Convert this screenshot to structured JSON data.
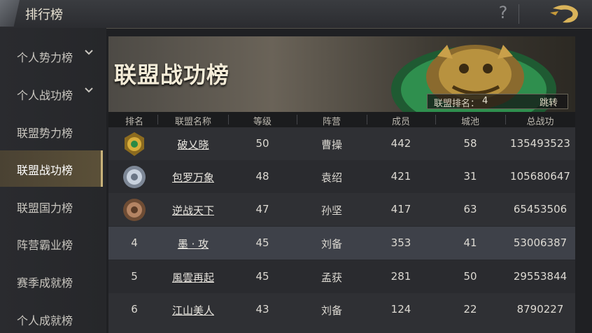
{
  "header": {
    "title": "排行榜",
    "help_glyph": "?"
  },
  "sidebar": {
    "items": [
      {
        "label": "个人势力榜",
        "has_chevron": true
      },
      {
        "label": "个人战功榜",
        "has_chevron": true
      },
      {
        "label": "联盟势力榜",
        "has_chevron": false
      },
      {
        "label": "联盟战功榜",
        "has_chevron": false,
        "active": true
      },
      {
        "label": "联盟国力榜",
        "has_chevron": false
      },
      {
        "label": "阵营霸业榜",
        "has_chevron": false
      },
      {
        "label": "赛季成就榜",
        "has_chevron": false
      },
      {
        "label": "个人成就榜",
        "has_chevron": false
      }
    ]
  },
  "banner": {
    "title": "联盟战功榜",
    "rank_label": "联盟排名：",
    "rank_value": "4",
    "jump_label": "跳转"
  },
  "table": {
    "headers": [
      "排名",
      "联盟名称",
      "等级",
      "阵营",
      "成员",
      "城池",
      "总战功"
    ],
    "rows": [
      {
        "rank": "",
        "medal": "gold-medal-icon",
        "name": "破乂晓",
        "level": "50",
        "camp": "曹操",
        "members": "442",
        "cities": "58",
        "merit": "135493523"
      },
      {
        "rank": "",
        "medal": "silver-medal-icon",
        "name": "包罗万象",
        "level": "48",
        "camp": "袁绍",
        "members": "421",
        "cities": "31",
        "merit": "105680647"
      },
      {
        "rank": "",
        "medal": "bronze-medal-icon",
        "name": "逆战天下",
        "level": "47",
        "camp": "孙坚",
        "members": "417",
        "cities": "63",
        "merit": "65453506"
      },
      {
        "rank": "4",
        "name": "墨 · 攻",
        "level": "45",
        "camp": "刘备",
        "members": "353",
        "cities": "41",
        "merit": "53006387"
      },
      {
        "rank": "5",
        "name": "風雲再起",
        "level": "45",
        "camp": "孟获",
        "members": "281",
        "cities": "50",
        "merit": "29553844"
      },
      {
        "rank": "6",
        "name": "江山美人",
        "level": "43",
        "camp": "刘备",
        "members": "124",
        "cities": "22",
        "merit": "8790227"
      }
    ]
  },
  "colors": {
    "accent": "#c8b27a",
    "highlight_row": "#3e4149",
    "row_a": "#2b2c30",
    "row_b": "#303135"
  }
}
